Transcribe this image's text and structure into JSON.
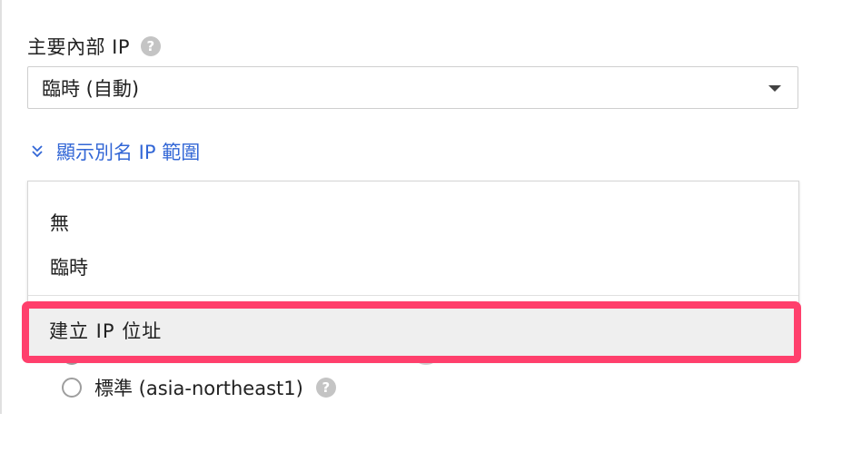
{
  "primary_ip": {
    "label": "主要內部 IP",
    "help": "?",
    "selected_value": "臨時 (自動)"
  },
  "alias_toggle": {
    "label": "顯示別名 IP 範圍"
  },
  "dropdown_menu": {
    "options": [
      "無",
      "臨時"
    ],
    "create_option": "建立 IP 位址"
  },
  "network_tier": {
    "standard_label": "標準 (asia-northeast1)",
    "help": "?"
  },
  "colors": {
    "accent_link": "#3367d6",
    "highlight_border": "#ff3f6c",
    "highlight_fill": "#efefef"
  }
}
